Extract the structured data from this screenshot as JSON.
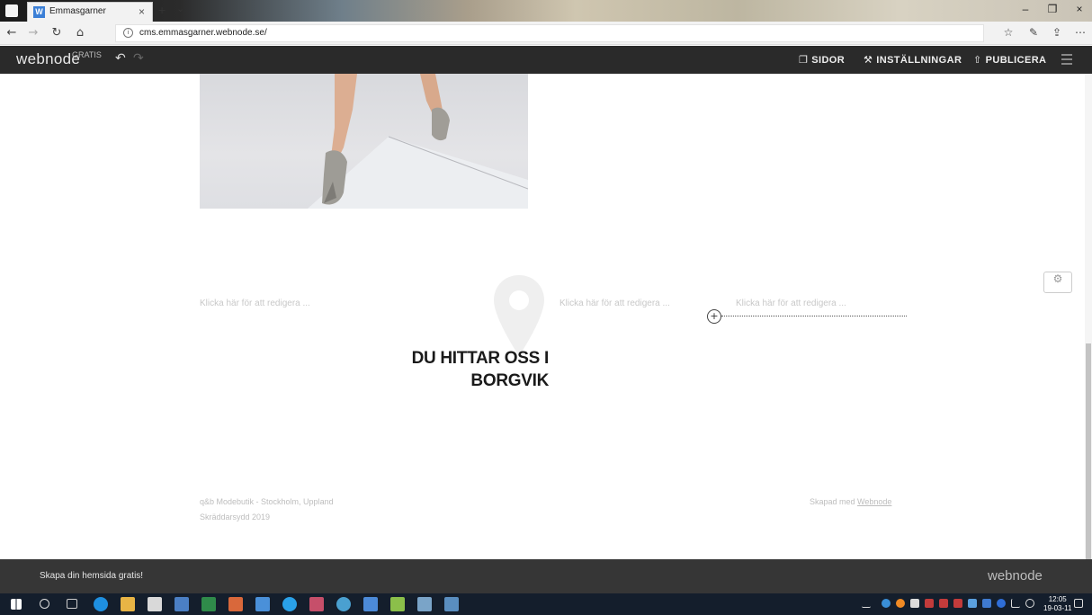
{
  "browser": {
    "tab_title": "Emmasgarner",
    "tab_favicon": "W",
    "url": "cms.emmasgarner.webnode.se/"
  },
  "toolbar": {
    "logo": "webnode",
    "plan_label": "GRATIS",
    "pages_label": "SIDOR",
    "settings_label": "INSTÄLLNINGAR",
    "publish_label": "PUBLICERA"
  },
  "content": {
    "placeholder_1": "Klicka här för att redigera ...",
    "placeholder_2": "Klicka här för att redigera ...",
    "placeholder_3": "Klicka här för att redigera ...",
    "headline_line1": "DU HITTAR OSS I",
    "headline_line2": "BORGVIK"
  },
  "footer": {
    "company": "q&b Modebutik - Stockholm, Uppland",
    "tagline": "Skräddarsydd 2019",
    "credit_prefix": "Skapad med ",
    "credit_link": "Webnode"
  },
  "promo": {
    "cta": "Skapa din hemsida gratis!",
    "logo": "webnode"
  },
  "taskbar": {
    "time": "12:05",
    "date": "19-03-11"
  },
  "colors": {
    "toolbar_bg": "#2a2a2a",
    "promo_bg": "#363636",
    "taskbar_bg": "#141e2c",
    "edge_blue": "#1e8fe0"
  }
}
